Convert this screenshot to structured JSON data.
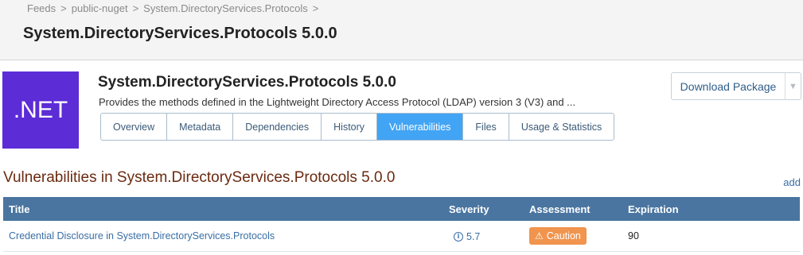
{
  "breadcrumb": {
    "items": [
      "Feeds",
      "public-nuget",
      "System.DirectoryServices.Protocols"
    ],
    "separator": ">"
  },
  "page_title": "System.DirectoryServices.Protocols 5.0.0",
  "package": {
    "logo_text": ".NET",
    "logo_color": "#5c2cd6",
    "title": "System.DirectoryServices.Protocols 5.0.0",
    "description": "Provides the methods defined in the Lightweight Directory Access Protocol (LDAP) version 3 (V3) and ..."
  },
  "tabs": [
    {
      "label": "Overview",
      "active": false
    },
    {
      "label": "Metadata",
      "active": false
    },
    {
      "label": "Dependencies",
      "active": false
    },
    {
      "label": "History",
      "active": false
    },
    {
      "label": "Vulnerabilities",
      "active": true
    },
    {
      "label": "Files",
      "active": false
    },
    {
      "label": "Usage & Statistics",
      "active": false
    }
  ],
  "download": {
    "label": "Download Package",
    "caret_icon": "caret-down-icon"
  },
  "section": {
    "title": "Vulnerabilities in System.DirectoryServices.Protocols 5.0.0",
    "add_label": "add"
  },
  "table": {
    "headers": {
      "title": "Title",
      "severity": "Severity",
      "assessment": "Assessment",
      "expiration": "Expiration"
    },
    "rows": [
      {
        "title": "Credential Disclosure in System.DirectoryServices.Protocols",
        "severity": "5.7",
        "assessment": "Caution",
        "expiration": "90"
      }
    ]
  },
  "colors": {
    "header_bg": "#4a75a0",
    "active_tab": "#42a4f4",
    "caution_badge": "#f0944e",
    "section_title": "#6b2a10"
  }
}
